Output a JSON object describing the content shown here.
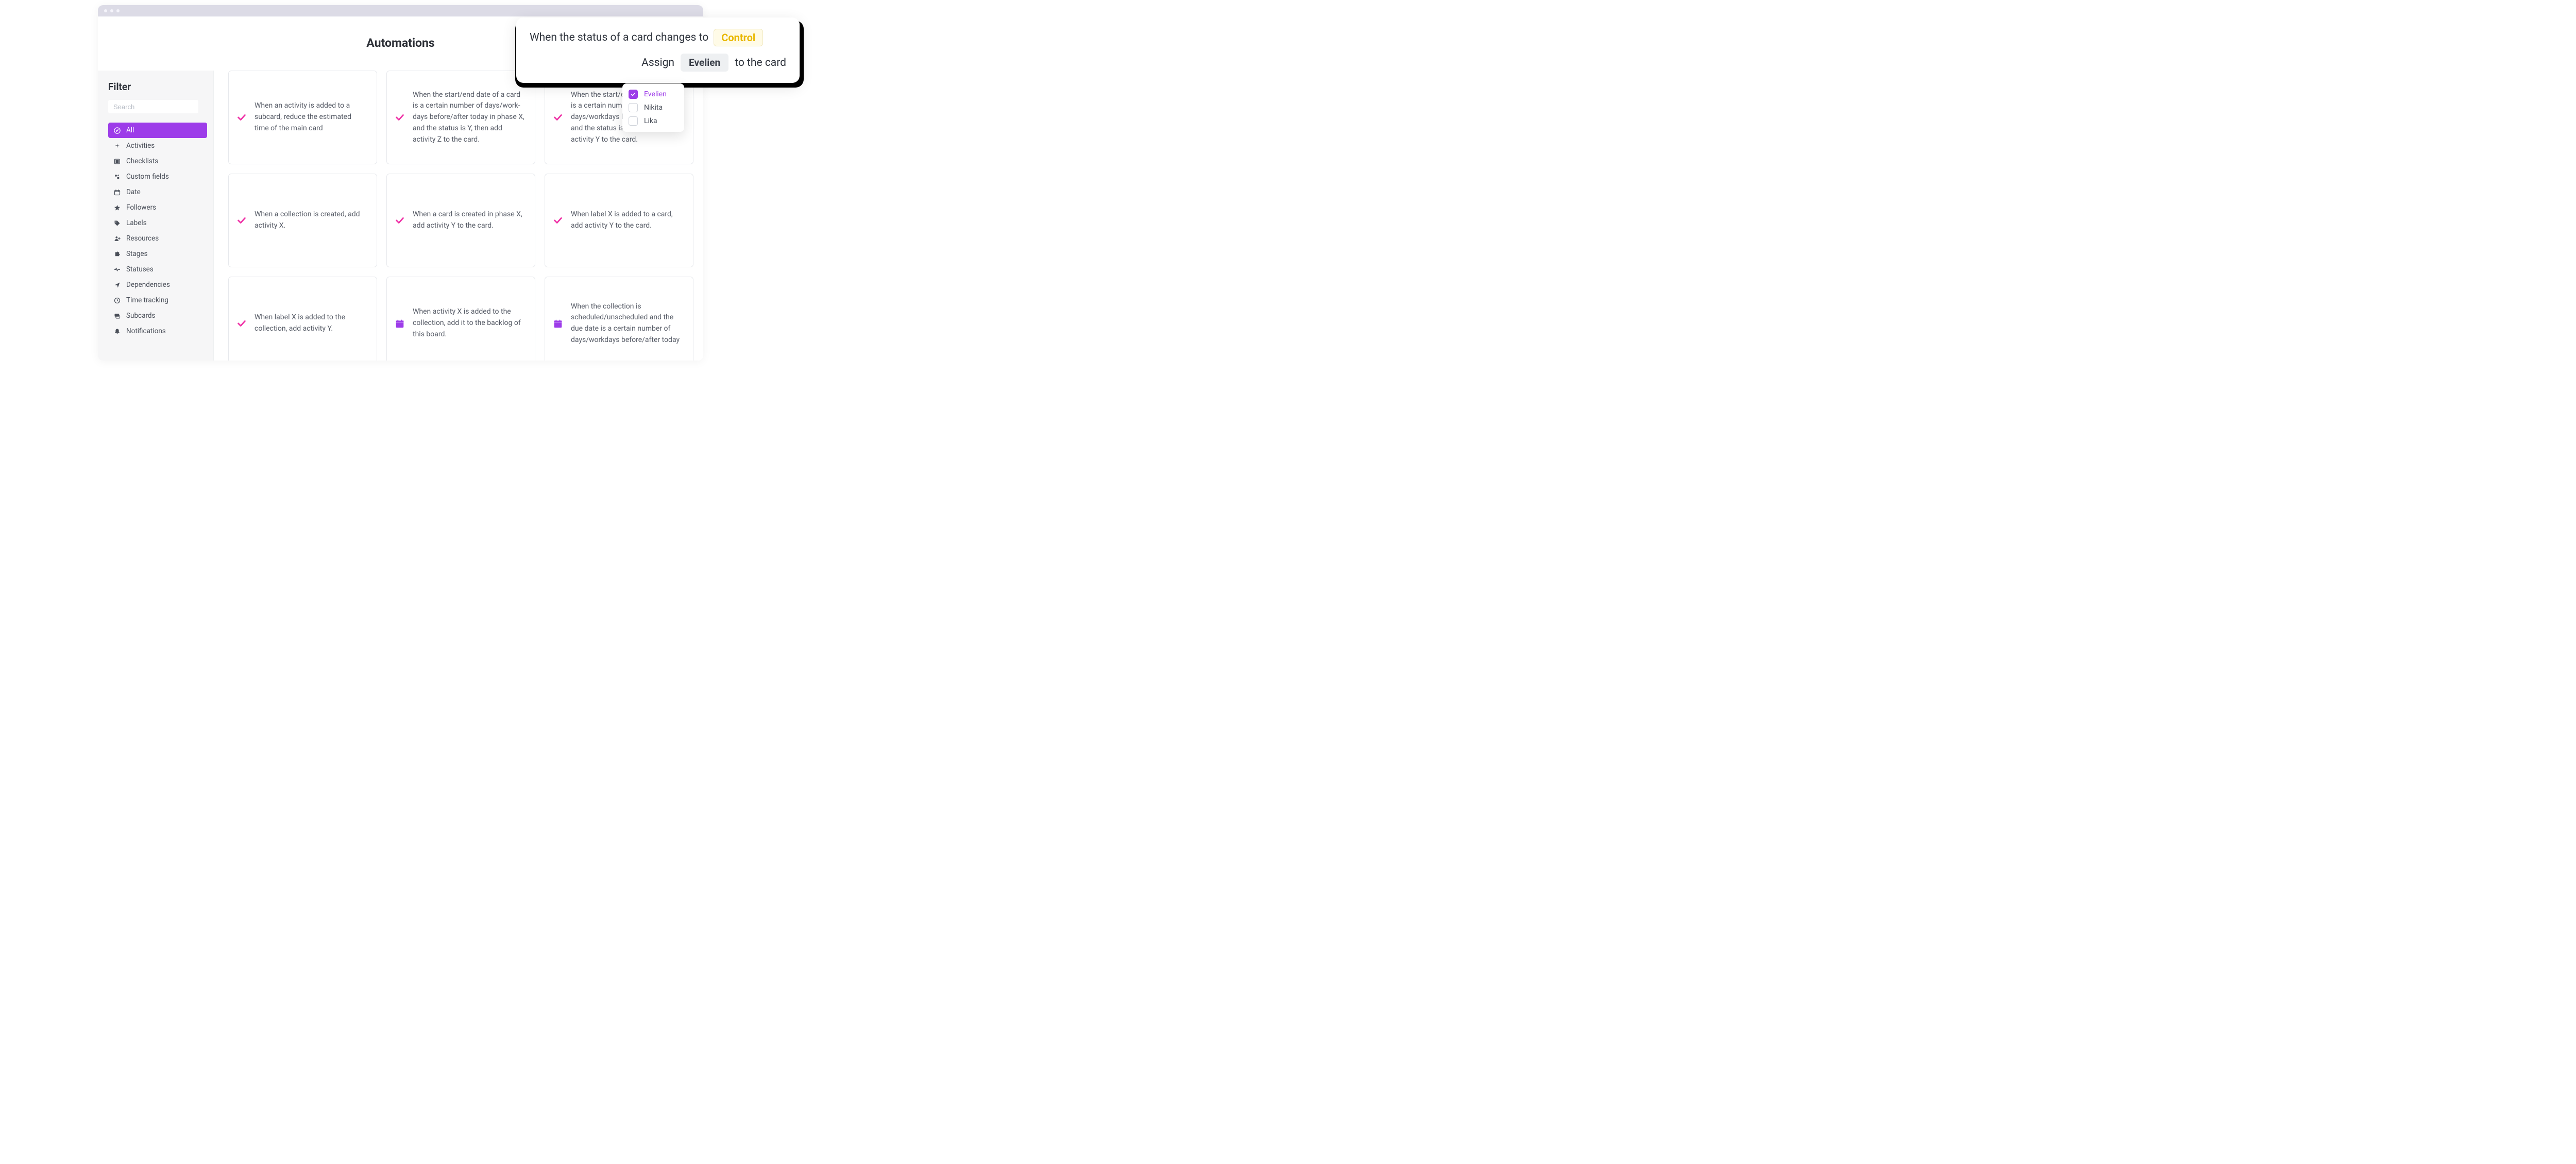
{
  "page": {
    "title": "Automations"
  },
  "sidebar": {
    "heading": "Filter",
    "search_placeholder": "Search",
    "items": [
      {
        "label": "All",
        "icon": "compass-icon",
        "active": true
      },
      {
        "label": "Activities",
        "icon": "sparkle-icon",
        "active": false
      },
      {
        "label": "Checklists",
        "icon": "list-icon",
        "active": false
      },
      {
        "label": "Custom fields",
        "icon": "shapes-icon",
        "active": false
      },
      {
        "label": "Date",
        "icon": "calendar-icon",
        "active": false
      },
      {
        "label": "Followers",
        "icon": "star-icon",
        "active": false
      },
      {
        "label": "Labels",
        "icon": "tag-icon",
        "active": false
      },
      {
        "label": "Resources",
        "icon": "person-plus-icon",
        "active": false
      },
      {
        "label": "Stages",
        "icon": "puzzle-icon",
        "active": false
      },
      {
        "label": "Statuses",
        "icon": "heartbeat-icon",
        "active": false
      },
      {
        "label": "Dependencies",
        "icon": "send-icon",
        "active": false
      },
      {
        "label": "Time tracking",
        "icon": "clock-icon",
        "active": false
      },
      {
        "label": "Subcards",
        "icon": "subcard-icon",
        "active": false
      },
      {
        "label": "Notifications",
        "icon": "bell-icon",
        "active": false
      }
    ]
  },
  "cards": [
    {
      "text": "When an activity is added to a subcard, reduce the estimated time of the main card",
      "icon": "check",
      "color": "#ef2fa5"
    },
    {
      "text": "When the start/end date of a card is a certain number of days/work-days before/after today in phase X, and the status is Y, then add activity Z to the card.",
      "icon": "check",
      "color": "#ef2fa5"
    },
    {
      "text": "When the start/end date of a card is a certain number of days/workdays before/after today and the status is X, then add activity Y to the card.",
      "icon": "check",
      "color": "#ef2fa5"
    },
    {
      "text": "When a collection is created, add activity X.",
      "icon": "check",
      "color": "#ef2fa5"
    },
    {
      "text": "When a card is created in phase X, add activity Y to the card.",
      "icon": "check",
      "color": "#ef2fa5"
    },
    {
      "text": "When label X is added to a card, add activity Y to the card.",
      "icon": "check",
      "color": "#ef2fa5"
    },
    {
      "text": "When label X is added to the collection, add activity Y.",
      "icon": "check",
      "color": "#ef2fa5"
    },
    {
      "text": "When activity X is added to the collection, add it to the backlog of this board.",
      "icon": "calendar",
      "color": "#9d3ce9"
    },
    {
      "text": "When the collection is scheduled/unscheduled and the due date is a certain number of days/workdays before/after today",
      "icon": "calendar",
      "color": "#9d3ce9"
    }
  ],
  "popover": {
    "line1_prefix": "When the status of a card changes to",
    "chip": "Control",
    "line2_prefix": "Assign",
    "person": "Evelien",
    "line2_suffix": "to the card"
  },
  "dropdown": {
    "options": [
      {
        "label": "Evelien",
        "checked": true
      },
      {
        "label": "Nikita",
        "checked": false
      },
      {
        "label": "Lika",
        "checked": false
      }
    ]
  },
  "colors": {
    "accent": "#9d3ce9",
    "pink": "#ef2fa5",
    "chip_text": "#e9b800"
  }
}
